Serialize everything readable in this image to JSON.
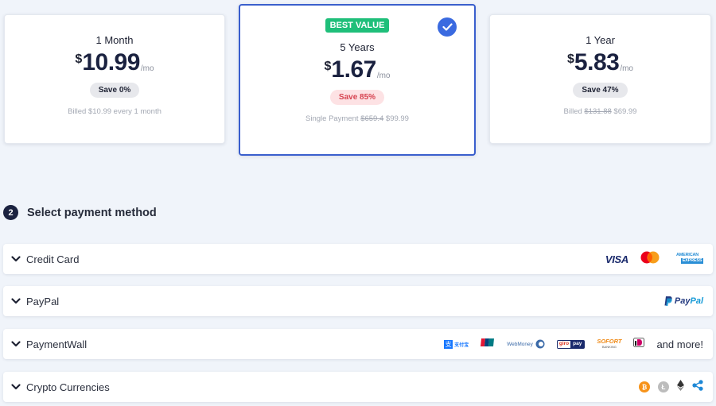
{
  "plans": [
    {
      "id": "1m",
      "title": "1 Month",
      "currency": "$",
      "price": "10.99",
      "unit": "/mo",
      "save": "Save 0%",
      "billed_prefix": "Billed $10.99 every 1 month",
      "billed_old": "",
      "billed_new": "",
      "selected": false
    },
    {
      "id": "5y",
      "badge": "BEST VALUE",
      "title": "5 Years",
      "currency": "$",
      "price": "1.67",
      "unit": "/mo",
      "save": "Save 85%",
      "billed_prefix": "Single Payment",
      "billed_old": "$659.4",
      "billed_new": "$99.99",
      "selected": true
    },
    {
      "id": "1y",
      "title": "1 Year",
      "currency": "$",
      "price": "5.83",
      "unit": "/mo",
      "save": "Save 47%",
      "billed_prefix": "Billed",
      "billed_old": "$131.88",
      "billed_new": "$69.99",
      "selected": false
    }
  ],
  "payment_section": {
    "step": "2",
    "title": "Select payment method",
    "methods": [
      {
        "label": "Credit Card",
        "logos": [
          "VISA",
          "Mastercard",
          "American Express"
        ]
      },
      {
        "label": "PayPal",
        "logos": [
          "PayPal"
        ]
      },
      {
        "label": "PaymentWall",
        "logos": [
          "Alipay",
          "UnionPay",
          "WebMoney",
          "giropay",
          "SOFORT Banking",
          "iDEAL"
        ],
        "more": "and more!"
      },
      {
        "label": "Crypto Currencies",
        "logos": [
          "Bitcoin",
          "Litecoin",
          "Ethereum",
          "Ripple"
        ]
      }
    ]
  },
  "logo_text": {
    "visa": "VISA",
    "amex_line1": "AMERICAN",
    "amex_line2": "EXPRESS",
    "paypal_a": "Pay",
    "paypal_b": "Pal",
    "webmoney": "WebMoney",
    "giro_a": "giro",
    "giro_b": "pay",
    "sofort": "SOFORT",
    "sofort_sub": "BANKING",
    "alipay": "支付宝",
    "unionpay": "银联"
  },
  "colors": {
    "accent": "#3a5fcd",
    "best_value": "#1fbf7a",
    "save_hot": "#d6424f",
    "background": "#f0f4fa"
  }
}
